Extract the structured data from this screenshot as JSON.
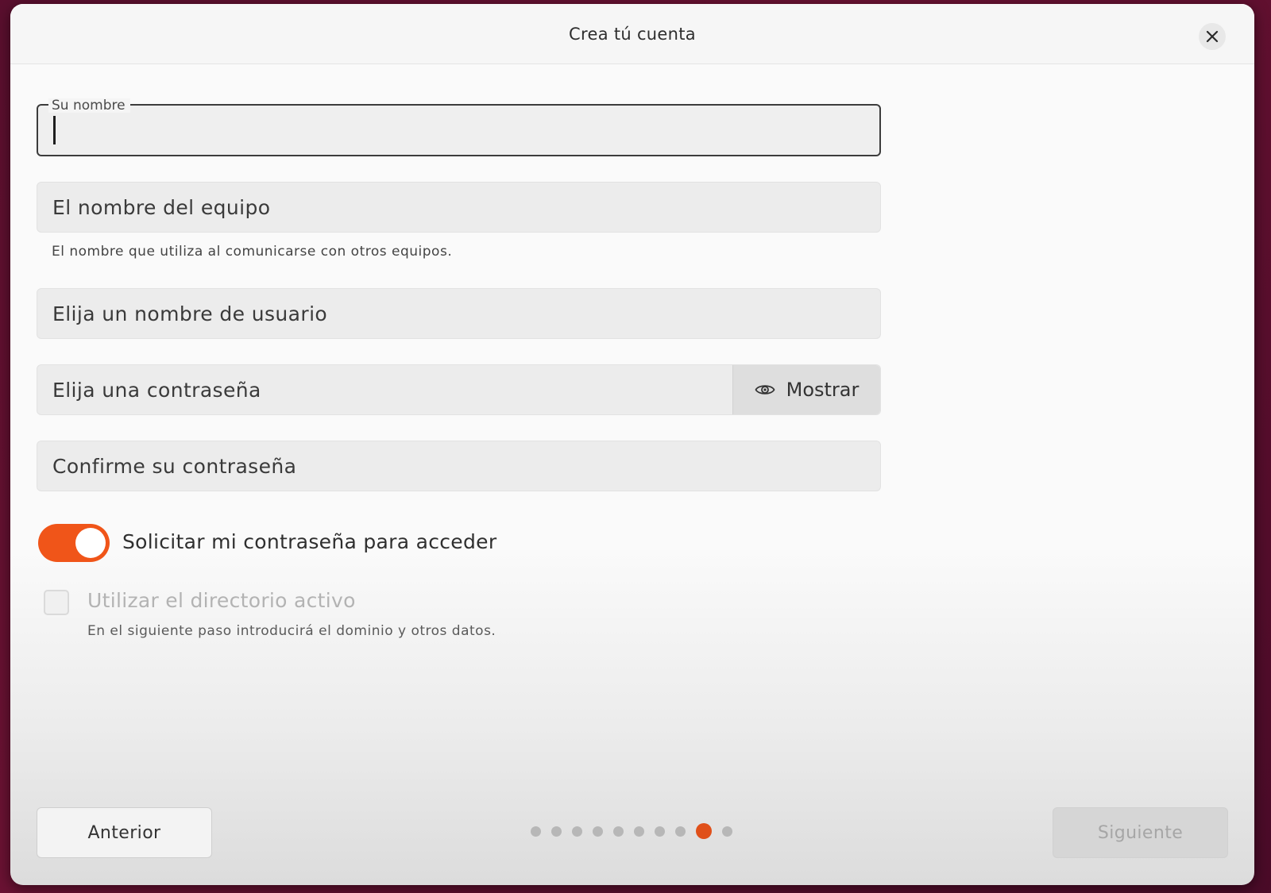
{
  "window": {
    "title": "Crea tú cuenta"
  },
  "form": {
    "name": {
      "label": "Su nombre",
      "value": ""
    },
    "computer_name": {
      "placeholder": "El nombre del equipo",
      "hint": "El nombre que utiliza al comunicarse con otros equipos."
    },
    "username": {
      "placeholder": "Elija un nombre de usuario"
    },
    "password": {
      "placeholder": "Elija una contraseña",
      "show_label": "Mostrar"
    },
    "confirm_password": {
      "placeholder": "Confirme su contraseña"
    },
    "require_password": {
      "label": "Solicitar mi contraseña para acceder",
      "checked": true
    },
    "active_directory": {
      "label": "Utilizar el directorio activo",
      "hint": "En el siguiente paso introducirá el dominio y otros datos.",
      "checked": false,
      "enabled": false
    }
  },
  "footer": {
    "prev_label": "Anterior",
    "next_label": "Siguiente",
    "steps_total": 10,
    "step_current": 9
  },
  "colors": {
    "accent": "#f05519",
    "active_dot": "#e0501a",
    "background": "#5a0f2e"
  },
  "icons": {
    "close": "close-icon",
    "show_password": "eye-icon"
  }
}
